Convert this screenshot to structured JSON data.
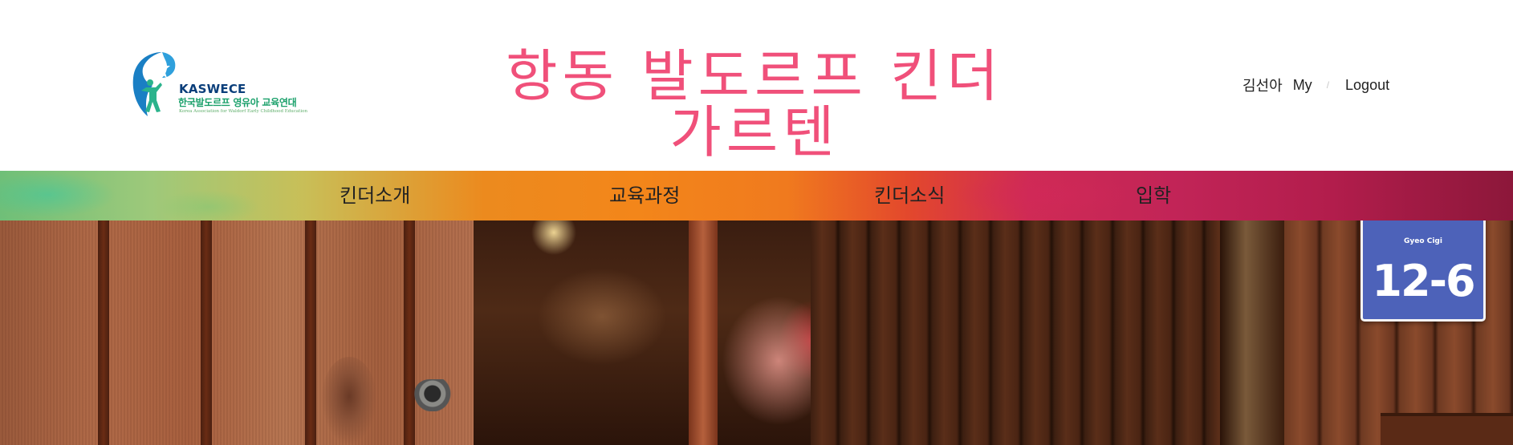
{
  "logo": {
    "org_name": "KASWECE",
    "org_name_kr": "한국발도르프 영유아 교육연대",
    "org_name_en": "Korea Association for Waldorf Early Childhood Education"
  },
  "site_title": "항동 발도르프 킨더가르텐",
  "user_bar": {
    "user_name": "김선아",
    "my_label": "My",
    "separator": "/",
    "logout_label": "Logout"
  },
  "nav": {
    "items": [
      {
        "label": "킨더소개"
      },
      {
        "label": "교육과정"
      },
      {
        "label": "킨더소식"
      },
      {
        "label": "입학"
      }
    ]
  },
  "hero": {
    "sign_text_small": "Gyeo Cigi",
    "sign_number": "12-6"
  },
  "colors": {
    "title_pink": "#f0507a",
    "text_dark": "#222222",
    "sign_blue": "#4d62b9"
  }
}
